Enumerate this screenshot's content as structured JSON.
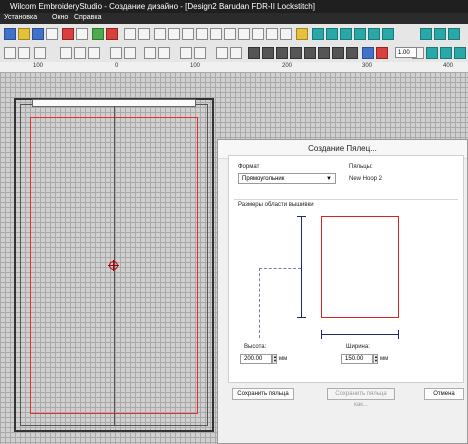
{
  "window": {
    "title": "Wilcom EmbroideryStudio - Создание дизайно - [Design2      Barudan FDR-II Lockstitch]"
  },
  "menu": {
    "items": [
      "Установка",
      "Окно",
      "Справка"
    ]
  },
  "toolbar": {
    "zoom_value": "1.00"
  },
  "ruler": {
    "labels": [
      "100",
      "0",
      "100",
      "200",
      "300",
      "400"
    ]
  },
  "dialog": {
    "title": "Создание Пялец...",
    "format_label": "Формат",
    "format_value": "Прямоугольник",
    "hoop_label": "Пяльцы:",
    "hoop_value": "New Hoop 2",
    "area_label": "Размеры области вышивки",
    "height_label": "Высота:",
    "height_value": "200.00",
    "height_unit": "мм",
    "width_label": "Ширина:",
    "width_value": "150.00",
    "width_unit": "мм",
    "save_button": "Сохранить пяльца",
    "save_as_button": "Сохранить пяльца как...",
    "cancel_button": "Отмена"
  },
  "colors": {
    "hoop_red": "#e03030",
    "dimension_blue": "#1b2a7a",
    "titlebar": "#1f1f1f"
  }
}
